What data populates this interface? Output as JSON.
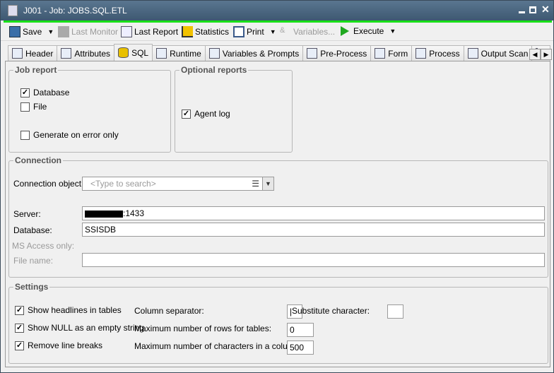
{
  "window": {
    "title": "J001 - Job: JOBS.SQL.ETL"
  },
  "toolbar": {
    "save": "Save",
    "last_monitor": "Last Monitor",
    "last_report": "Last Report",
    "statistics": "Statistics",
    "print": "Print",
    "variables": "Variables...",
    "execute": "Execute"
  },
  "tabs": [
    {
      "label": "Header"
    },
    {
      "label": "Attributes"
    },
    {
      "label": "SQL",
      "active": true
    },
    {
      "label": "Runtime"
    },
    {
      "label": "Variables & Prompts"
    },
    {
      "label": "Pre-Process"
    },
    {
      "label": "Form"
    },
    {
      "label": "Process"
    },
    {
      "label": "Output Scan"
    },
    {
      "label": "D"
    }
  ],
  "job_report": {
    "title": "Job report",
    "database": {
      "label": "Database",
      "checked": true
    },
    "file": {
      "label": "File",
      "checked": false
    },
    "error_only": {
      "label": "Generate on error only",
      "checked": false
    }
  },
  "optional_reports": {
    "title": "Optional reports",
    "agent_log": {
      "label": "Agent log",
      "checked": true
    }
  },
  "connection": {
    "title": "Connection",
    "object_label": "Connection object:",
    "object_placeholder": "<Type to search>",
    "server_label": "Server:",
    "server_value": ":1433",
    "database_label": "Database:",
    "database_value": "SSISDB",
    "ms_access_label": "MS Access only:",
    "file_name_label": "File name:",
    "file_name_value": ""
  },
  "settings": {
    "title": "Settings",
    "show_headlines": {
      "label": "Show headlines in tables",
      "checked": true
    },
    "show_null": {
      "label": "Show NULL as an empty string",
      "checked": true
    },
    "remove_breaks": {
      "label": "Remove line breaks",
      "checked": true
    },
    "col_sep_label": "Column separator:",
    "col_sep_value": "|",
    "subst_label": "Substitute character:",
    "subst_value": "",
    "max_rows_label": "Maximum number of rows for tables:",
    "max_rows_value": "0",
    "max_chars_label": "Maximum number of characters in a column:",
    "max_chars_value": "500"
  },
  "colors": {
    "titlebar": "#3e5871",
    "accent_green": "#18e018"
  }
}
